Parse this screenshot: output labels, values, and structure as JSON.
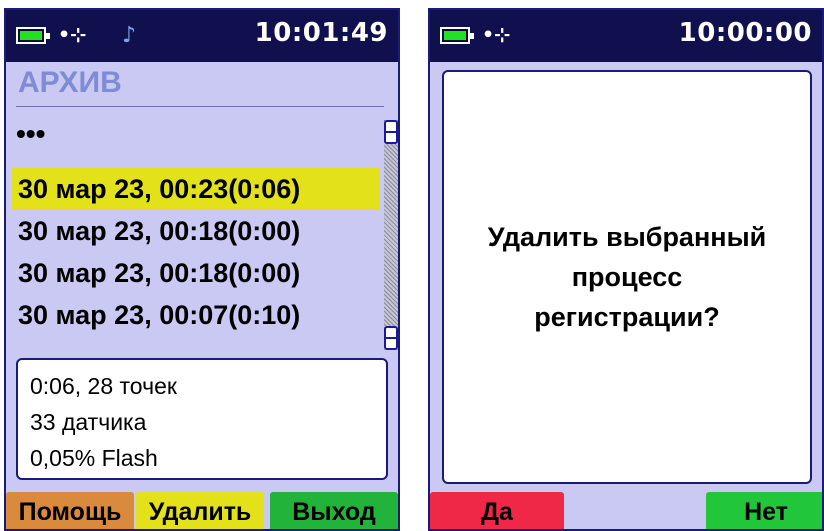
{
  "left_screen": {
    "status": {
      "time": "10:01:49",
      "icons": [
        "battery-icon",
        "usb-icon",
        "music-note-icon"
      ]
    },
    "title": "АРХИВ",
    "more_indicator": "•••",
    "records": [
      {
        "label": "30 мар 23, 00:23(0:06)",
        "selected": true
      },
      {
        "label": "30 мар 23, 00:18(0:00)",
        "selected": false
      },
      {
        "label": "30 мар 23, 00:18(0:00)",
        "selected": false
      },
      {
        "label": "30 мар 23, 00:07(0:10)",
        "selected": false
      }
    ],
    "info": [
      "0:06, 28 точек",
      "33 датчика",
      "0,05% Flash"
    ],
    "softkeys": {
      "help": "Помощь",
      "delete": "Удалить",
      "exit": "Выход"
    },
    "colors": {
      "selected_row": "#e3e21a",
      "help": "#d98a3c",
      "delete": "#e3e21a",
      "exit": "#22b33a"
    }
  },
  "right_screen": {
    "status": {
      "time": "10:00:00",
      "icons": [
        "battery-icon",
        "usb-icon"
      ]
    },
    "dialog_lines": [
      "Удалить выбранный",
      "процесс",
      "регистрации?"
    ],
    "softkeys": {
      "yes": "Да",
      "no": "Нет"
    },
    "colors": {
      "yes": "#f02848",
      "no": "#22c63a"
    }
  },
  "theme": {
    "background": "#c9c9f3",
    "statusbar": "#10104e"
  }
}
